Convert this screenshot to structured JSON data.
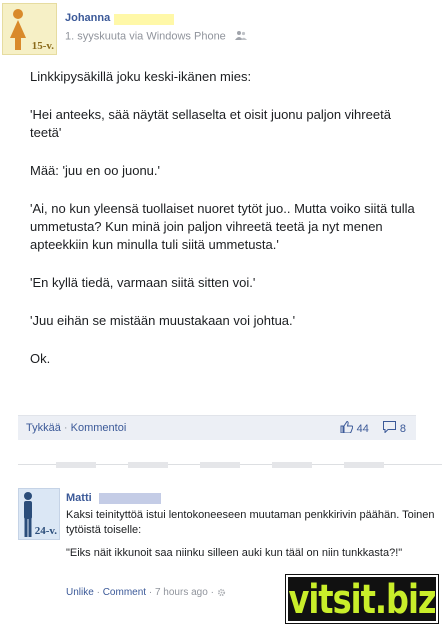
{
  "post": {
    "author_name": "Johanna",
    "age_badge": "15-v.",
    "meta": "1. syyskuuta via Windows Phone",
    "paragraphs": [
      "Linkkipysäkillä joku keski-ikänen mies:",
      "'Hei anteeks, sää näytät sellaselta et oisit juonu paljon vihreetä teetä'",
      "Mää: 'juu en oo juonu.'",
      "'Ai, no kun yleensä tuollaiset nuoret tytöt juo.. Mutta voiko siitä tulla ummetusta? Kun minä join paljon vihreetä teetä ja nyt menen apteekkiin kun minulla tuli siitä ummetusta.'",
      "'En kyllä tiedä, varmaan siitä sitten voi.'",
      "'Juu eihän se mistään muustakaan voi johtua.'",
      "Ok."
    ],
    "actions": {
      "like_label": "Tykkää",
      "separator": "·",
      "comment_label": "Kommentoi",
      "likes_count": "44",
      "comments_count": "8"
    }
  },
  "comment": {
    "author_name": "Matti",
    "age_badge": "24-v.",
    "line1": "Kaksi teinityttöä istui lentokoneeseen muutaman penkkirivin päähän. Toinen tytöistä toiselle:",
    "line2": "\"Eiks näit ikkunoit saa niinku silleen auki kun tääl on niin tunkkasta?!\"",
    "like_label": "Unlike",
    "separator": "·",
    "comment_label": "Comment",
    "time": "7 hours ago"
  },
  "watermark": "vitsit.biz",
  "colors": {
    "link": "#3b5998",
    "muted": "#90949c",
    "watermark_green": "#c9ee2a"
  }
}
